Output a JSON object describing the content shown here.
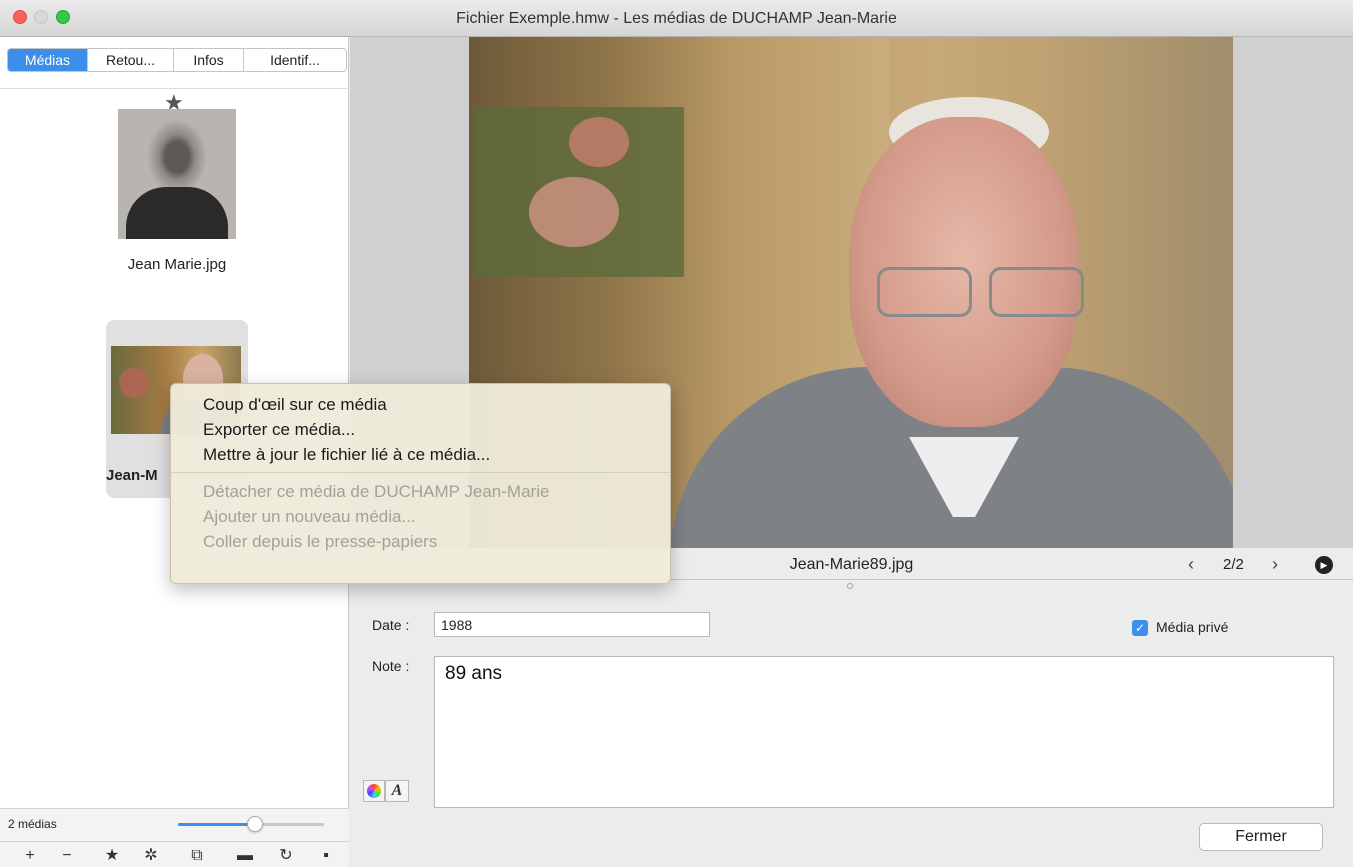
{
  "window": {
    "title": "Fichier Exemple.hmw - Les médias de DUCHAMP Jean-Marie"
  },
  "tabs": [
    {
      "label": "Médias",
      "active": true
    },
    {
      "label": "Retou..."
    },
    {
      "label": "Infos"
    },
    {
      "label": "Identif..."
    }
  ],
  "media_list": {
    "items": [
      {
        "filename": "Jean Marie.jpg",
        "starred": true
      },
      {
        "filename": "Jean-M",
        "selected": true
      }
    ],
    "count_label": "2 médias",
    "zoom_level": 0.53
  },
  "toolbar_icons": [
    "add-icon",
    "remove-icon",
    "star-icon",
    "gear-icon",
    "gallery-icon",
    "folder-icon",
    "refresh-icon",
    "save-icon"
  ],
  "toolbar_glyphs": [
    "+",
    "−",
    "★",
    "✲",
    "⧉",
    "▬",
    "↻",
    "▪"
  ],
  "viewer": {
    "filename": "Jean-Marie89.jpg",
    "position": "2/2",
    "prev_glyph": "‹",
    "next_glyph": "›",
    "play_glyph": "▶"
  },
  "form": {
    "date_label": "Date :",
    "date_value": "1988",
    "note_label": "Note :",
    "note_value": "89 ans",
    "private_label": "Média privé",
    "private_checked": true,
    "font_button_label": "A",
    "close_label": "Fermer"
  },
  "context_menu": {
    "items": [
      {
        "label": "Coup d'œil sur ce média",
        "enabled": true
      },
      {
        "label": "Exporter ce média...",
        "enabled": true
      },
      {
        "label": "Mettre à jour le fichier lié à ce média...",
        "enabled": true
      },
      {
        "label": "Détacher ce média de DUCHAMP Jean-Marie",
        "enabled": false
      },
      {
        "label": "Ajouter un nouveau média...",
        "enabled": false
      },
      {
        "label": "Coller depuis le presse-papiers",
        "enabled": false
      }
    ]
  },
  "colors": {
    "accent": "#3b8eea",
    "menu_bg": "#eeebda",
    "disabled_text": "#a3a198"
  }
}
